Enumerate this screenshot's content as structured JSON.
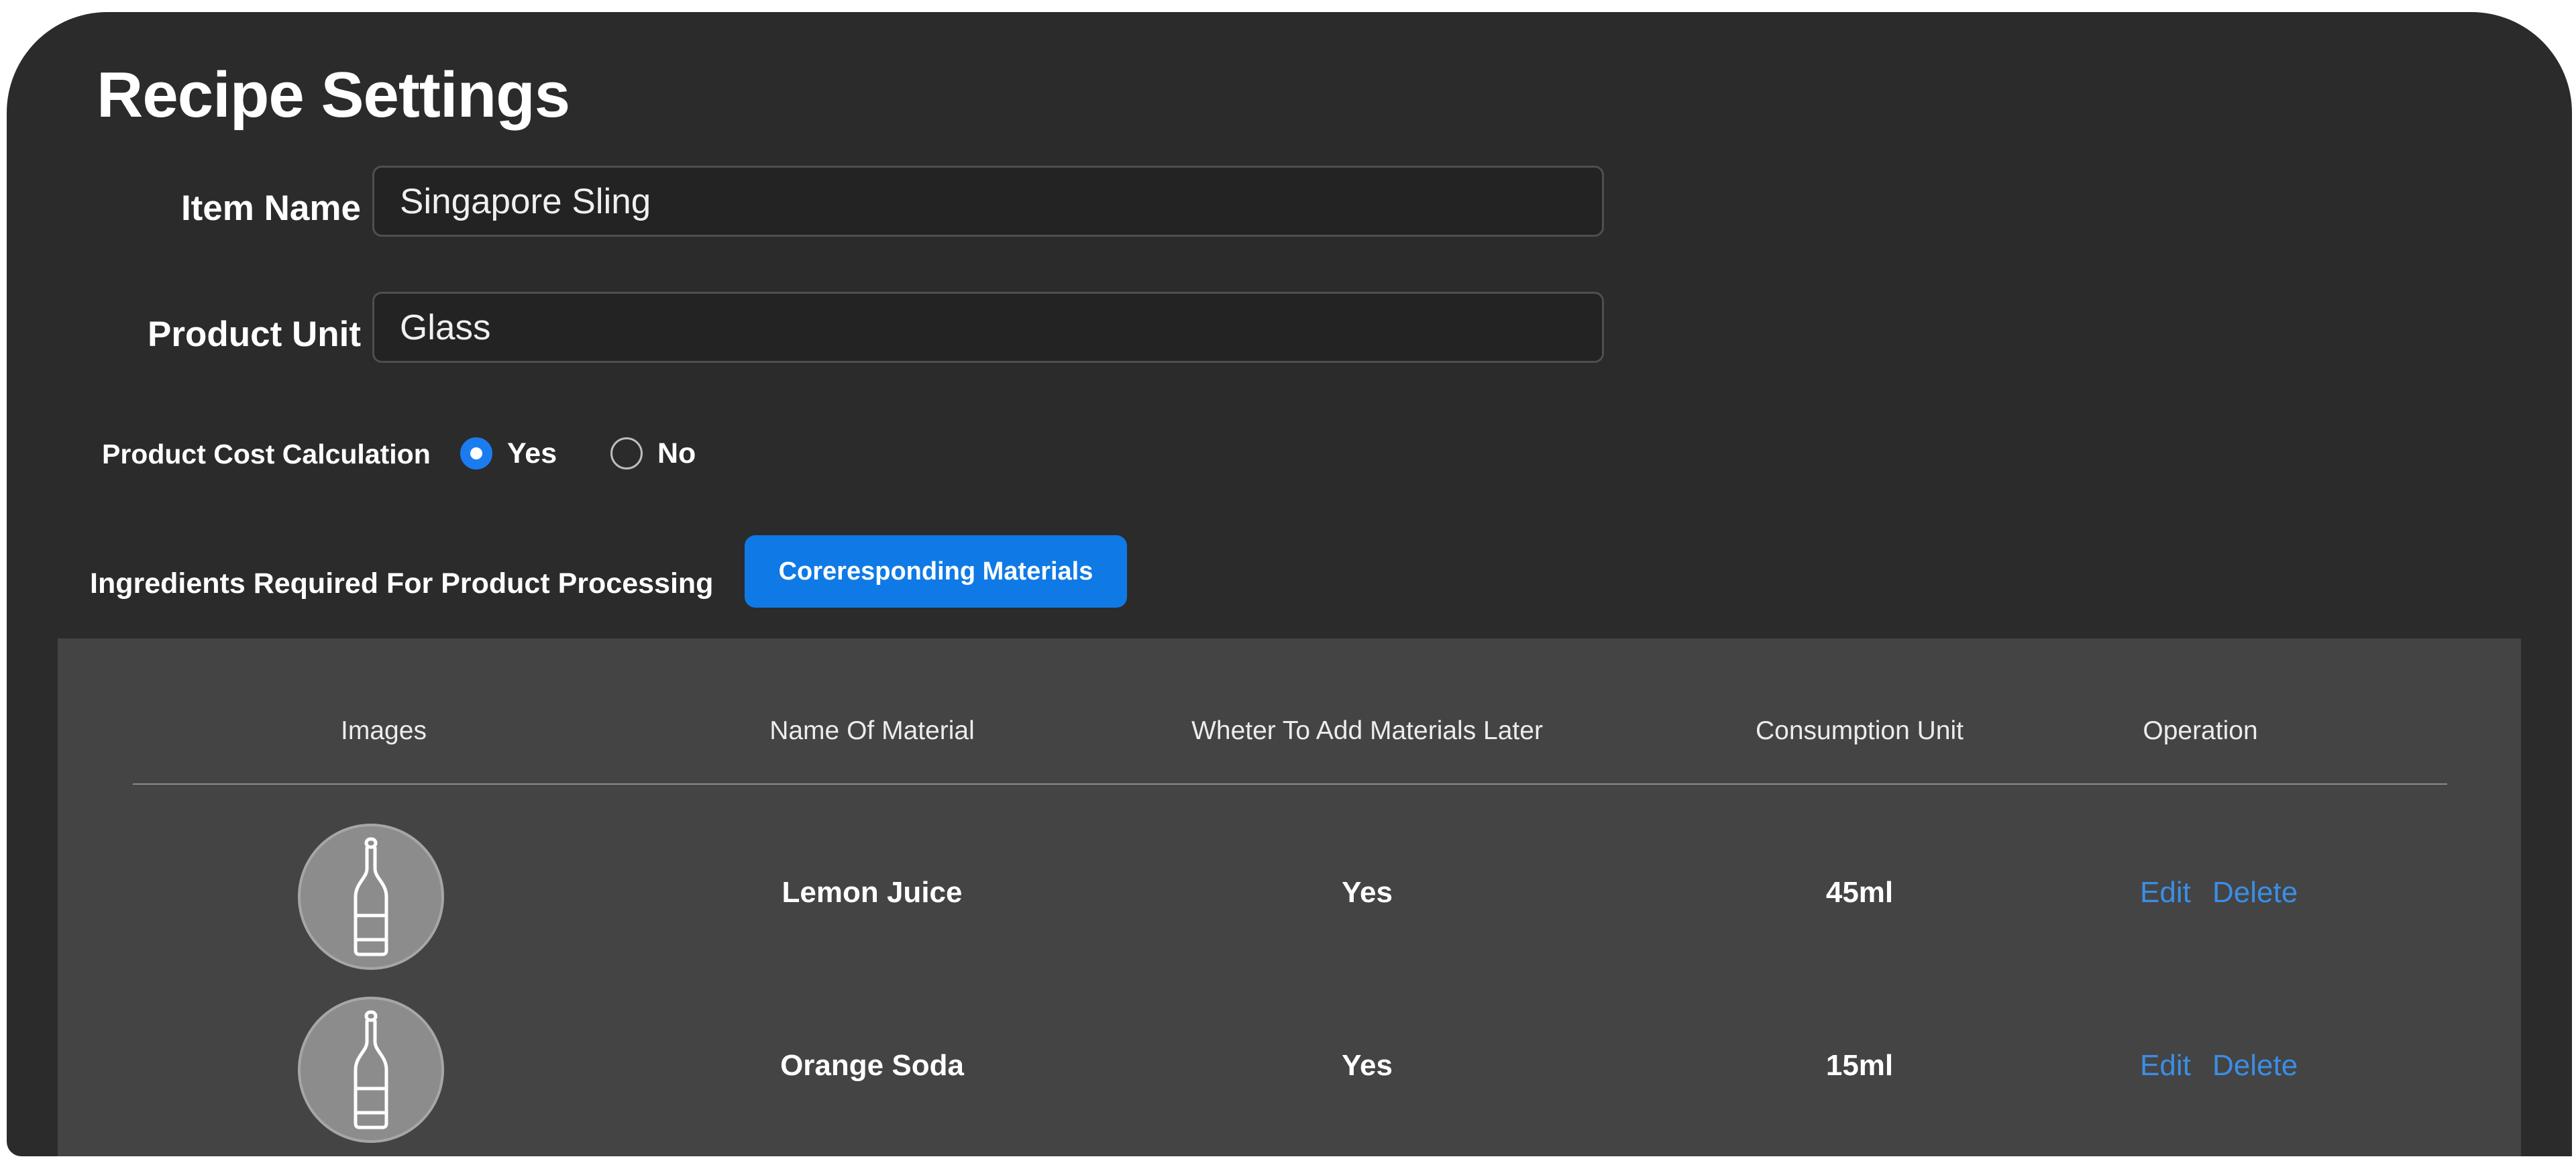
{
  "page": {
    "title": "Recipe Settings"
  },
  "form": {
    "item_name_label": "Item Name",
    "item_name_value": "Singapore Sling",
    "product_unit_label": "Product Unit",
    "product_unit_value": "Glass",
    "cost_calc_label": "Product Cost Calculation",
    "cost_calc_options": [
      {
        "label": "Yes",
        "selected": true
      },
      {
        "label": "No",
        "selected": false
      }
    ]
  },
  "ingredients": {
    "section_label": "Ingredients Required For Product Processing",
    "button_label": "Coreresponding Materials"
  },
  "table": {
    "headers": [
      "Images",
      "Name Of Material",
      "Wheter To Add Materials Later",
      "Consumption Unit",
      "Operation"
    ],
    "rows": [
      {
        "image_icon": "bottle-icon",
        "name": "Lemon Juice",
        "add_later": "Yes",
        "unit": "45ml",
        "edit": "Edit",
        "delete": "Delete"
      },
      {
        "image_icon": "bottle-icon",
        "name": "Orange Soda",
        "add_later": "Yes",
        "unit": "15ml",
        "edit": "Edit",
        "delete": "Delete"
      }
    ]
  },
  "colors": {
    "panel_background": "#2b2b2b",
    "table_background": "#444444",
    "accent_blue": "#0f7ae5",
    "link_blue": "#3a8ee6"
  }
}
